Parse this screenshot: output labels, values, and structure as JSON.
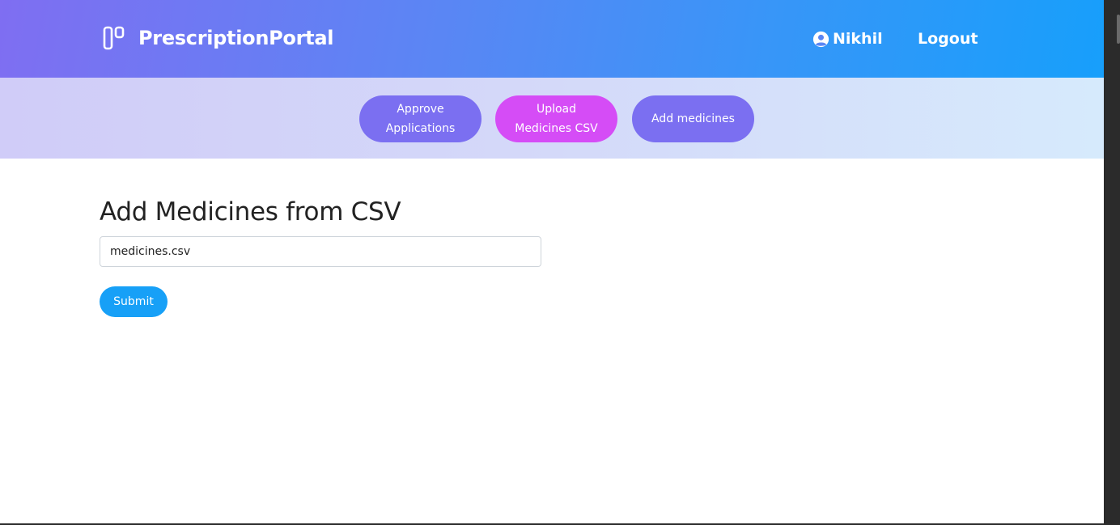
{
  "navbar": {
    "brand": "PrescriptionPortal",
    "brand_icon": "columns-icon",
    "user_name": "Nikhil",
    "user_icon": "user-circle-icon",
    "logout": "Logout"
  },
  "subnav": {
    "items": [
      {
        "label": "Approve Applications",
        "color": "#7b6ff1",
        "active": false
      },
      {
        "label": "Upload Medicines CSV",
        "color": "#d54cf6",
        "active": true
      },
      {
        "label": "Add medicines",
        "color": "#7b6ff1",
        "active": false
      }
    ]
  },
  "main": {
    "title": "Add Medicines from CSV",
    "file_value": "medicines.csv",
    "submit_label": "Submit"
  },
  "colors": {
    "primary": "#17a0f7",
    "accent": "#d54cf6",
    "purple": "#7b6ff1"
  }
}
